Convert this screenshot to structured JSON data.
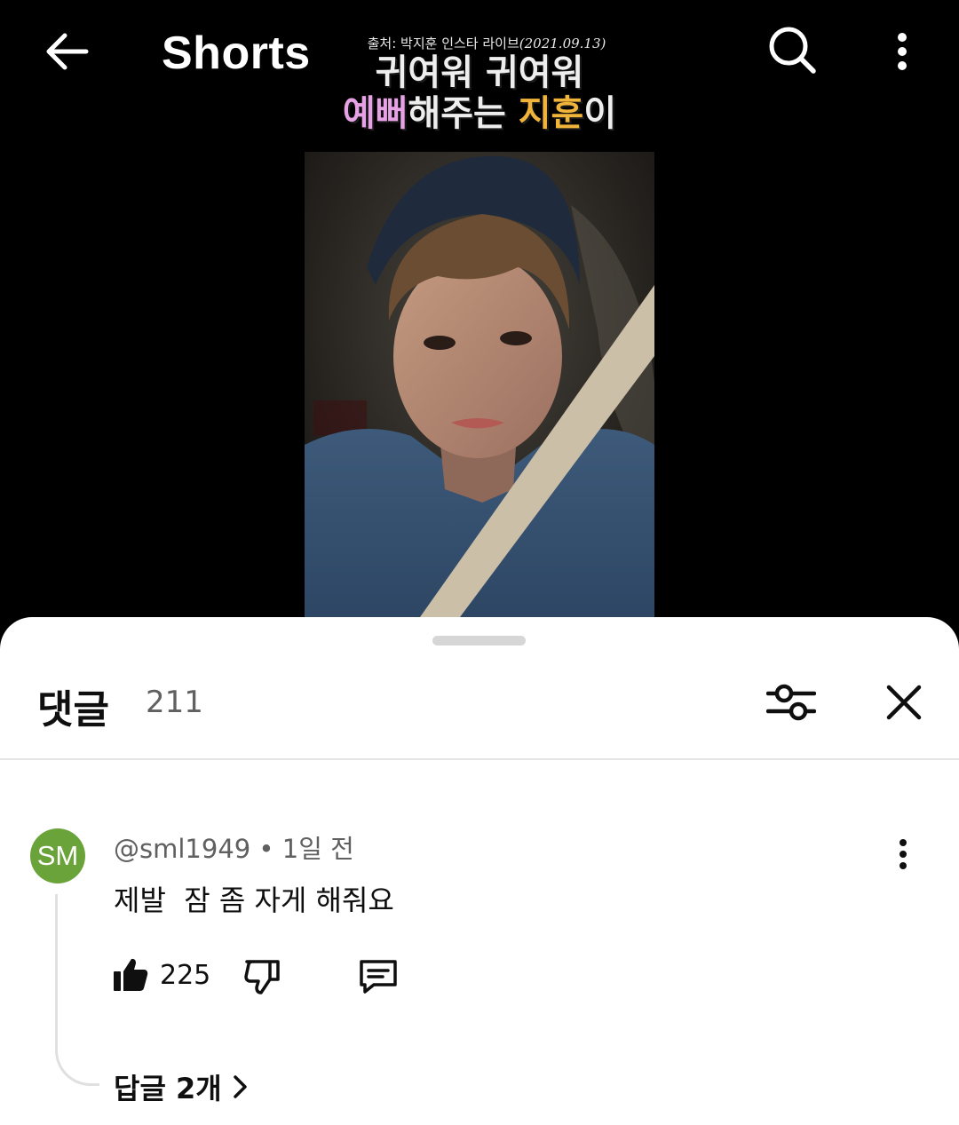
{
  "header": {
    "title": "Shorts",
    "back_icon": "arrow-left-icon",
    "search_icon": "search-icon",
    "more_icon": "more-vertical-icon"
  },
  "video": {
    "caption_source": "출처: 박지훈 인스타 라이브",
    "caption_date": "(2021.09.13)",
    "headline_line1": "귀여워 귀여워",
    "headline_line2_pink": "예뻐",
    "headline_line2_mid": "해주는 ",
    "headline_line2_gold": "지훈",
    "headline_line2_end": "이",
    "colors": {
      "pink": "#e7a2e6",
      "gold": "#f0b43a"
    }
  },
  "comments_panel": {
    "title": "댓글",
    "count": "211",
    "filter_icon": "sliders-icon",
    "close_icon": "close-icon"
  },
  "comment": {
    "avatar_initials": "SM",
    "avatar_color": "#6aa33a",
    "author": "@sml1949",
    "separator": " • ",
    "time": "1일 전",
    "text": "제발  잠 좀 자게 해줘요",
    "likes": "225",
    "replies_label": "답글 2개"
  }
}
